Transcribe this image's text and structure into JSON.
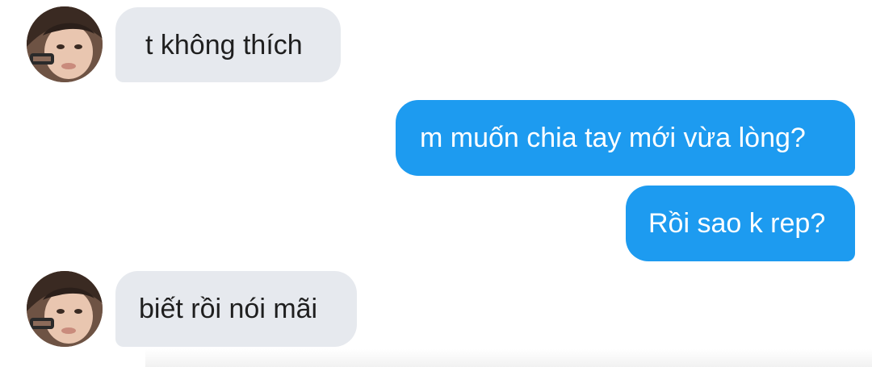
{
  "messages": [
    {
      "direction": "incoming",
      "text": "t không thích"
    },
    {
      "direction": "outgoing",
      "text": "m muốn chia tay mới vừa lòng?"
    },
    {
      "direction": "outgoing",
      "text": "Rồi sao k rep?"
    },
    {
      "direction": "incoming",
      "text": "biết rồi nói mãi"
    }
  ],
  "colors": {
    "incoming_bubble": "#e6e9ee",
    "incoming_text": "#1f1f1f",
    "outgoing_bubble": "#1d9bf0",
    "outgoing_text": "#ffffff"
  }
}
